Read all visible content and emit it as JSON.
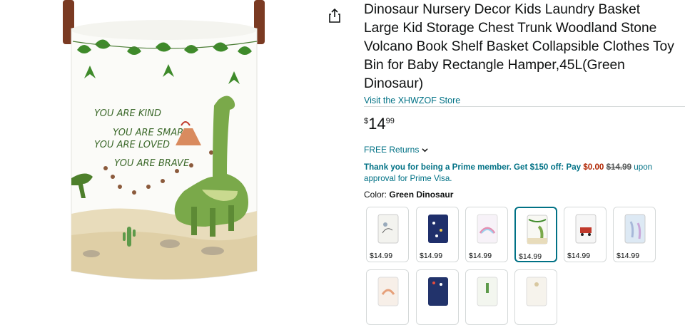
{
  "product": {
    "title": "Dinosaur Nursery Decor Kids Laundry Basket Large Kid Storage Chest Trunk Woodland Stone Volcano Book Shelf Basket Collapsible Clothes Toy Bin for Baby Rectangle Hamper,45L(Green Dinosaur)",
    "store_link": "Visit the XHWZOF Store",
    "price": {
      "symbol": "$",
      "whole": "14",
      "fraction": "99"
    },
    "returns": "FREE Returns",
    "prime": {
      "lead": "Thank you for being a Prime member. Get $150 off: Pay",
      "new_price": "$0.00",
      "old_price": "$14.99",
      "tail_inline": "upon",
      "tail_next": "approval for Prime Visa."
    },
    "color_label": "Color:",
    "color_value": "Green Dinosaur"
  },
  "basket_text": {
    "line1": "YOU ARE KIND",
    "line2": "YOU ARE SMART",
    "line3": "YOU ARE LOVED",
    "line4": "YOU ARE BRAVE"
  },
  "swatches": [
    {
      "price": "$14.99",
      "selected": false,
      "pattern": "dinosaur-sketch"
    },
    {
      "price": "$14.99",
      "selected": false,
      "pattern": "space-navy"
    },
    {
      "price": "$14.99",
      "selected": false,
      "pattern": "unicorn-rainbow"
    },
    {
      "price": "$14.99",
      "selected": true,
      "pattern": "green-dinosaur"
    },
    {
      "price": "$14.99",
      "selected": false,
      "pattern": "red-car"
    },
    {
      "price": "$14.99",
      "selected": false,
      "pattern": "blue-llama"
    },
    {
      "price": "",
      "selected": false,
      "pattern": "rainbow"
    },
    {
      "price": "",
      "selected": false,
      "pattern": "navy-stars"
    },
    {
      "price": "",
      "selected": false,
      "pattern": "cactus"
    },
    {
      "price": "",
      "selected": false,
      "pattern": "light-pattern"
    }
  ],
  "colors": {
    "link": "#007185",
    "price_red": "#b12704",
    "text": "#0f1111",
    "strap": "#7a3a22",
    "leaf": "#3e8a2a"
  },
  "icons": {
    "share": "share-icon",
    "returns_chevron": "chevron-down-icon"
  }
}
